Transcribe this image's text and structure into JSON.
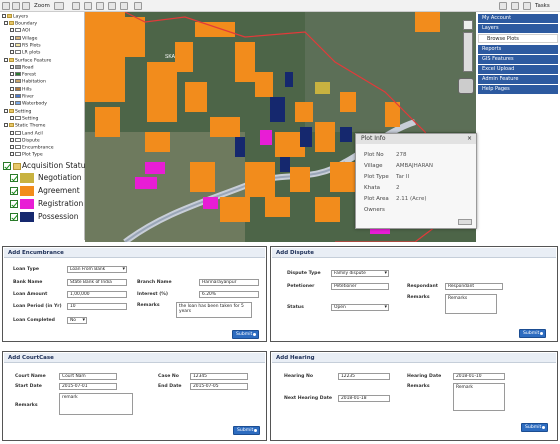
{
  "toolbar": {
    "zoom_label": "Zoom",
    "tasks_label": "Tasks"
  },
  "layers": {
    "title": "Layers",
    "items": [
      {
        "label": "Boundary"
      },
      {
        "label": "AOI"
      },
      {
        "label": "Village"
      },
      {
        "label": "RS Plots"
      },
      {
        "label": "LR plots"
      },
      {
        "label": "Surface Feature"
      },
      {
        "label": "Road"
      },
      {
        "label": "Forest"
      },
      {
        "label": "Habitation"
      },
      {
        "label": "Hills"
      },
      {
        "label": "River"
      },
      {
        "label": "Waterbody"
      },
      {
        "label": "Setting"
      },
      {
        "label": "Setting"
      },
      {
        "label": "Static Theme"
      },
      {
        "label": "Land Acil"
      },
      {
        "label": "Dispute"
      },
      {
        "label": "Encumbrance"
      },
      {
        "label": "Plot Type"
      }
    ],
    "swatch_colors": [
      "#ffffff",
      "#ffffff",
      "#d9b37a",
      "#f2e6a8",
      "#ffffff",
      "#ffffff",
      "#999999",
      "#2e7d32",
      "#c9a66b",
      "#b07a3f",
      "#4a7bd0",
      "#79a9e6",
      "#ffffff",
      "#ffffff",
      "#ffffff",
      "#ffffff",
      "#ffffff",
      "#ffffff",
      "#ffffff"
    ]
  },
  "legend": {
    "title": "Acquisition Status",
    "items": [
      {
        "label": "Negotiation",
        "color": "#c8b240"
      },
      {
        "label": "Agreement",
        "color": "#f28c1c"
      },
      {
        "label": "Registration",
        "color": "#e81dd5"
      },
      {
        "label": "Possession",
        "color": "#15286e"
      }
    ]
  },
  "map": {
    "label_text": "SKA"
  },
  "menu": {
    "items": [
      {
        "label": "My Account"
      },
      {
        "label": "Layers"
      },
      {
        "label": "Browse Plots"
      },
      {
        "label": "Reports"
      },
      {
        "label": "GIS Features"
      },
      {
        "label": "Excel Upload"
      },
      {
        "label": "Admin Feature"
      },
      {
        "label": "Help Pages"
      }
    ]
  },
  "plot_info": {
    "title": "Plot Info",
    "rows": [
      {
        "key": "Plot No",
        "value": "278"
      },
      {
        "key": "Village",
        "value": "AMBAJHARAN"
      },
      {
        "key": "Plot Type",
        "value": "Tar II"
      },
      {
        "key": "Khata",
        "value": "2"
      },
      {
        "key": "Plot Area",
        "value": "2.11 (Acre)"
      },
      {
        "key": "Owners",
        "value": ""
      }
    ]
  },
  "encumbrance": {
    "title": "Add Encumbrance",
    "loan_type_label": "Loan Type",
    "loan_type_value": "Loan From Bank",
    "bank_name_label": "Bank Name",
    "bank_name_value": "State Bank of India",
    "branch_name_label": "Branch Name",
    "branch_name_value": "Harinarayanpur",
    "loan_amount_label": "Loan Amount",
    "loan_amount_value": "1,00,000",
    "interest_label": "Interest (%)",
    "interest_value": "6.20%",
    "loan_period_label": "Loan Period (in Yr)",
    "loan_period_value": "10",
    "remarks_label": "Remarks",
    "remarks_value": "the loan has been taken for 5 years",
    "loan_completed_label": "Loan Completed",
    "loan_completed_value": "No",
    "submit_label": "Submit"
  },
  "dispute": {
    "title": "Add Dispute",
    "dispute_type_label": "Dispute Type",
    "dispute_type_value": "Family dispute",
    "petitioner_label": "Petetioner",
    "petitioner_value": "Petetioner",
    "respondant_label": "Respondant",
    "respondant_value": "Respondant",
    "status_label": "Status",
    "status_value": "Open",
    "remarks_label": "Remarks",
    "remarks_value": "Remarks",
    "submit_label": "Submit"
  },
  "courtcase": {
    "title": "Add CourtCase",
    "court_name_label": "Court Name",
    "court_name_value": "Court Nam",
    "case_no_label": "Case No",
    "case_no_value": "12345",
    "start_date_label": "Start Date",
    "start_date_value": "2015-07-01",
    "end_date_label": "End Date",
    "end_date_value": "2015-07-05",
    "remarks_label": "Remarks",
    "remarks_value": "remark",
    "submit_label": "Submit"
  },
  "hearing": {
    "title": "Add Hearing",
    "hearing_no_label": "Hearing No",
    "hearing_no_value": "12235",
    "hearing_date_label": "Hearing Date",
    "hearing_date_value": "2018-01-10",
    "next_hearing_label": "Next Hearing Date",
    "next_hearing_value": "2018-01-18",
    "remarks_label": "Remarks",
    "remarks_value": "Remark",
    "submit_label": "Submit"
  }
}
